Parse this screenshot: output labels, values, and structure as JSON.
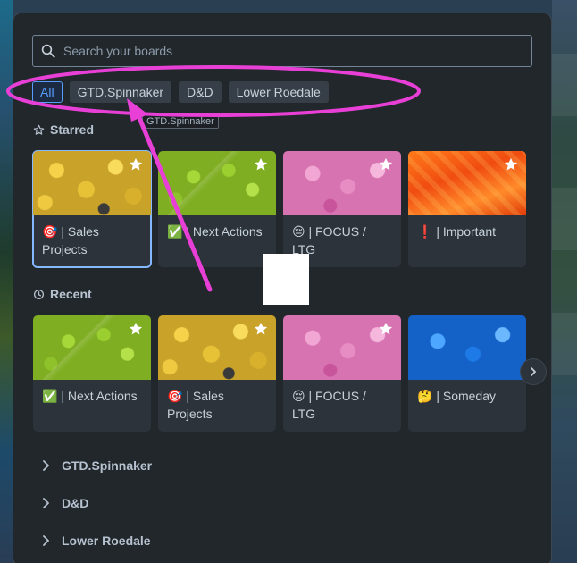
{
  "search": {
    "placeholder": "Search your boards"
  },
  "filters": [
    "All",
    "GTD.Spinnaker",
    "D&D",
    "Lower Roedale"
  ],
  "tooltip": "GTD.Spinnaker",
  "starred": {
    "heading": "Starred",
    "cards": [
      {
        "emoji": "🎯",
        "label": "| Sales Projects",
        "theme": "yellow"
      },
      {
        "emoji": "✅",
        "label": "| Next Actions",
        "theme": "green"
      },
      {
        "emoji": "😔",
        "label": "| FOCUS / LTG",
        "theme": "pink"
      },
      {
        "emoji": "❗",
        "label": "| Important",
        "theme": "orange"
      }
    ]
  },
  "recent": {
    "heading": "Recent",
    "cards": [
      {
        "emoji": "✅",
        "label": "| Next Actions",
        "theme": "green"
      },
      {
        "emoji": "🎯",
        "label": "| Sales Projects",
        "theme": "yellow"
      },
      {
        "emoji": "😔",
        "label": "| FOCUS / LTG",
        "theme": "pink"
      },
      {
        "emoji": "🤔",
        "label": "| Someday",
        "theme": "blue"
      }
    ]
  },
  "workspaces": [
    "GTD.Spinnaker",
    "D&D",
    "Lower Roedale"
  ],
  "colors": {
    "panel": "#22272b",
    "accent": "#579dff",
    "annotation": "#e83fd7"
  },
  "icons": {
    "search": "search-icon",
    "star": "star-icon",
    "clock": "clock-icon",
    "chevron_right": "chevron-right-icon"
  }
}
